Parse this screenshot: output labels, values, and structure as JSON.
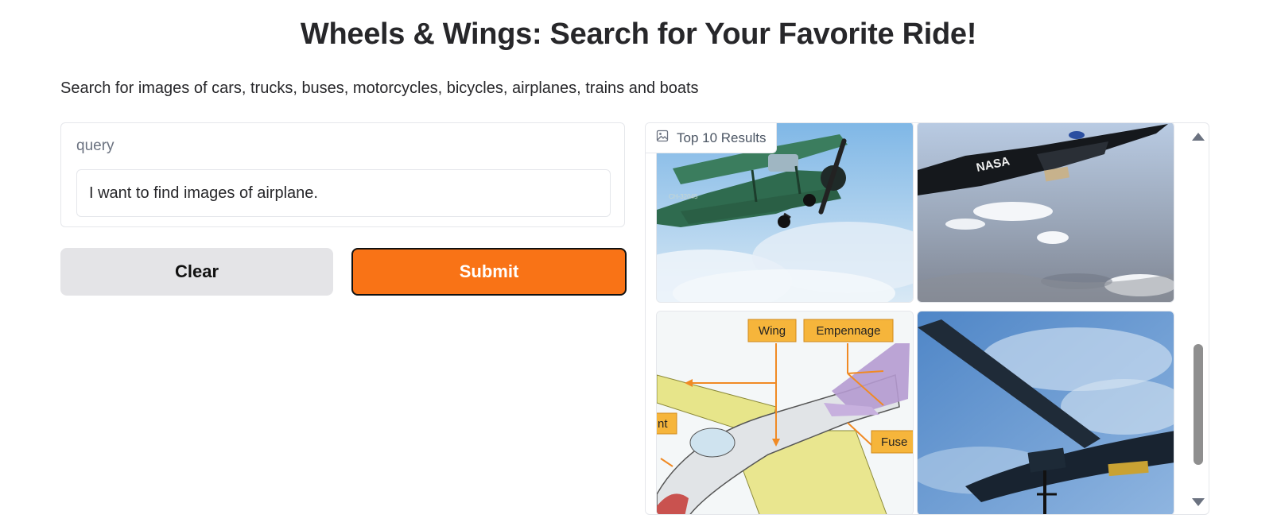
{
  "page": {
    "title": "Wheels & Wings: Search for Your Favorite Ride!",
    "subtitle": "Search for images of cars, trucks, buses, motorcycles, bicycles, airplanes, trains and boats"
  },
  "query": {
    "label": "query",
    "value": "I want to find images of airplane."
  },
  "buttons": {
    "clear": "Clear",
    "submit": "Submit"
  },
  "gallery": {
    "label": "Top 10 Results",
    "label_icon": "image-icon",
    "images": [
      {
        "name": "green biplane in sky"
      },
      {
        "name": "black NASA X-43 aircraft over landscape",
        "text": "NASA"
      },
      {
        "name": "labeled airplane parts diagram",
        "labels": [
          "Wing",
          "Empennage",
          "Fuse",
          "nt"
        ]
      },
      {
        "name": "dark drone aircraft against blue sky"
      }
    ]
  },
  "colors": {
    "submit_bg": "#f97316",
    "clear_bg": "#e4e4e7"
  }
}
